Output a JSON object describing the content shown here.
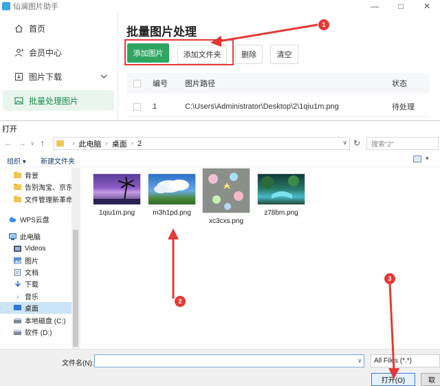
{
  "app": {
    "title": "仙澜图片助手",
    "window_controls": [
      "—",
      "□",
      "✕"
    ]
  },
  "sidebar": {
    "items": [
      {
        "label": "首页",
        "icon": "home-icon"
      },
      {
        "label": "会员中心",
        "icon": "user-plus-icon"
      },
      {
        "label": "图片下载",
        "icon": "download-icon"
      },
      {
        "label": "批量处理图片",
        "icon": "image-icon"
      }
    ],
    "active_index": 3
  },
  "main": {
    "title": "批量图片处理",
    "buttons": {
      "add_image": "添加图片",
      "add_folder": "添加文件夹",
      "delete": "删除",
      "clear": "清空"
    },
    "table": {
      "headers": [
        "编号",
        "图片路径",
        "状态"
      ],
      "rows": [
        {
          "no": "1",
          "path": "C:\\Users\\Administrator\\Desktop\\2\\1qiu1m.png",
          "status": "待处理"
        }
      ]
    }
  },
  "dialog": {
    "title": "打开",
    "breadcrumb": [
      "此电脑",
      "桌面",
      "2"
    ],
    "search_placeholder": "搜索\"2\"",
    "toolbar": {
      "organize": "组织 ▾",
      "new_folder": "新建文件夹"
    },
    "nav_pane": [
      {
        "label": "背景",
        "icon": "folder-icon"
      },
      {
        "label": "告别淘宝、京东商",
        "icon": "folder-icon"
      },
      {
        "label": "文件管理新革命，",
        "icon": "folder-icon"
      },
      {
        "label": "WPS云盘",
        "icon": "cloud-icon"
      },
      {
        "label": "此电脑",
        "icon": "computer-icon"
      },
      {
        "label": "Videos",
        "icon": "video-icon"
      },
      {
        "label": "图片",
        "icon": "pictures-icon"
      },
      {
        "label": "文档",
        "icon": "document-icon"
      },
      {
        "label": "下载",
        "icon": "download-arrow-icon"
      },
      {
        "label": "音乐",
        "icon": "music-icon"
      },
      {
        "label": "桌面",
        "icon": "desktop-icon"
      },
      {
        "label": "本地磁盘 (C:)",
        "icon": "drive-icon"
      },
      {
        "label": "软件 (D:)",
        "icon": "drive-icon"
      }
    ],
    "nav_selected_index": 10,
    "files": [
      {
        "name": "1qiu1m.png"
      },
      {
        "name": "m3h1pd.png"
      },
      {
        "name": "xc3cxs.png"
      },
      {
        "name": "z78bm.png"
      }
    ],
    "filename_label": "文件名(N):",
    "filename_value": "",
    "file_type": "All Files (*.*)",
    "open_button": "打开(O)",
    "cancel_button": "取"
  },
  "annotations": {
    "markers": [
      "1",
      "2",
      "3"
    ],
    "color": "#e53935"
  },
  "colors": {
    "accent": "#2fa562",
    "annotation": "#e53935",
    "selection": "#cce4f7"
  }
}
